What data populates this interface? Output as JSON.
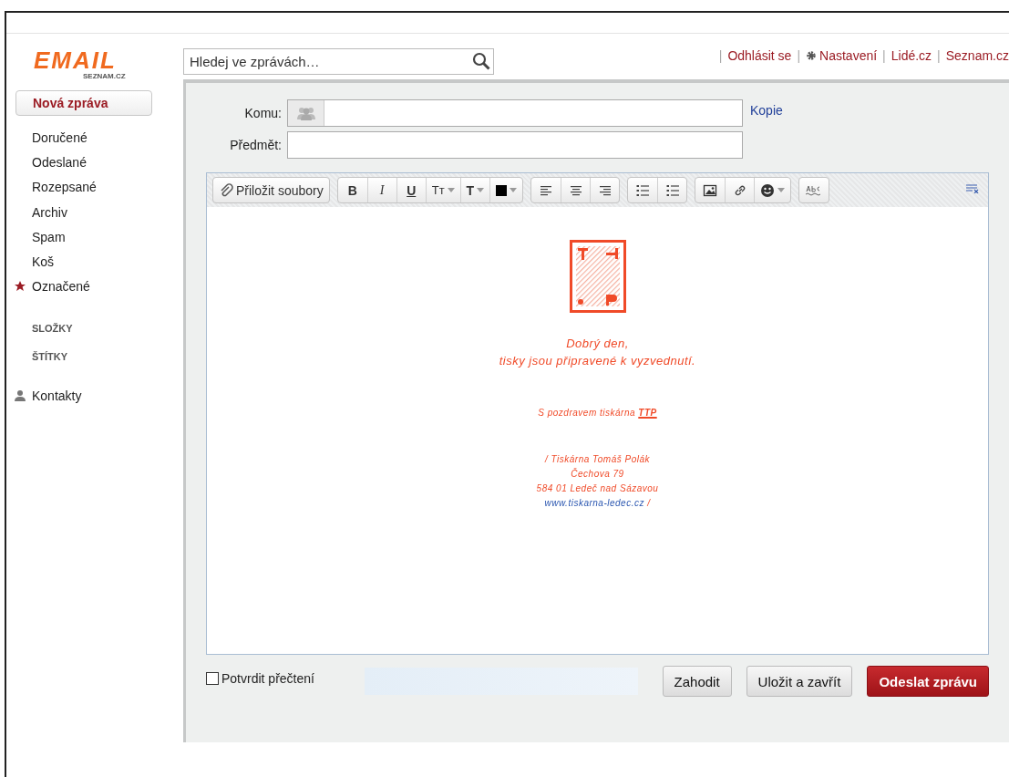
{
  "logo": {
    "title": "EMAIL",
    "subtitle": "SEZNAM.CZ"
  },
  "sidebar": {
    "new_message": "Nová zpráva",
    "folders": [
      {
        "label": "Doručené",
        "starred": false
      },
      {
        "label": "Odeslané",
        "starred": false
      },
      {
        "label": "Rozepsané",
        "starred": false
      },
      {
        "label": "Archiv",
        "starred": false
      },
      {
        "label": "Spam",
        "starred": false
      },
      {
        "label": "Koš",
        "starred": false
      },
      {
        "label": "Označené",
        "starred": true
      }
    ],
    "sections": [
      "SLOŽKY",
      "ŠTÍTKY"
    ],
    "contacts": "Kontakty"
  },
  "search": {
    "placeholder": "Hledej ve zprávách…"
  },
  "top_links": [
    {
      "separator": "|",
      "label": "Odhlásit se",
      "kind": "plain"
    },
    {
      "separator": "|",
      "label": "Nastavení",
      "kind": "settings"
    },
    {
      "separator": "|",
      "label": "Lidé.cz",
      "kind": "plain"
    },
    {
      "separator": "|",
      "label": "Seznam.cz",
      "kind": "plain"
    }
  ],
  "compose": {
    "to_label": "Komu:",
    "copy_link": "Kopie",
    "subject_label": "Předmět:",
    "toolbar": [
      [
        {
          "kind": "attach",
          "label": "Přiložit soubory"
        }
      ],
      [
        {
          "kind": "bold",
          "label": "B"
        },
        {
          "kind": "italic",
          "label": "I"
        },
        {
          "kind": "underline",
          "label": "U"
        },
        {
          "kind": "fontsize",
          "label": "Tт",
          "dropdown": true
        },
        {
          "kind": "textstyle",
          "label": "T",
          "dropdown": true
        },
        {
          "kind": "color",
          "dropdown": true
        }
      ],
      [
        {
          "kind": "alignleft"
        },
        {
          "kind": "aligncenter"
        },
        {
          "kind": "alignright"
        }
      ],
      [
        {
          "kind": "numbered"
        },
        {
          "kind": "bulleted"
        }
      ],
      [
        {
          "kind": "image"
        },
        {
          "kind": "link"
        },
        {
          "kind": "emoji",
          "dropdown": true
        }
      ],
      [
        {
          "kind": "spellcheck"
        }
      ]
    ],
    "body": {
      "greeting": [
        "Dobrý den,",
        "tisky jsou připravené k vyzvednutí."
      ],
      "signature": "S pozdravem tiskárna **TTP**",
      "address": [
        "/ Tiskárna Tomáš Polák",
        "Čechova 79",
        "584 01 Ledeč nad Sázavou"
      ],
      "website": {
        "link": "www.tiskarna-ledec.cz",
        "after": " /"
      }
    },
    "read_receipt": {
      "label": "Potvrdit přečtení",
      "checked": false
    },
    "buttons": [
      {
        "label": "Zahodit",
        "kind": "secondary"
      },
      {
        "label": "Uložit a zavřít",
        "kind": "secondary"
      },
      {
        "label": "Odeslat zprávu",
        "kind": "primary"
      }
    ]
  }
}
